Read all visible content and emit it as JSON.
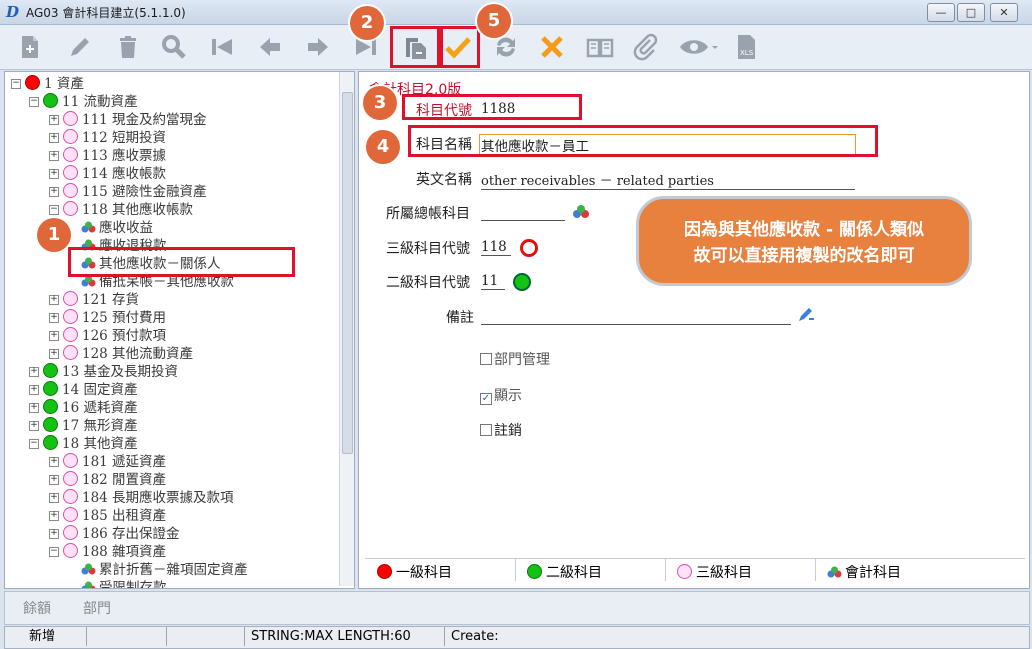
{
  "window": {
    "title": "AG03 會計科目建立(5.1.1.0)",
    "logo": "D",
    "minimize": "—",
    "restore": "□",
    "close": "✕"
  },
  "toolbar": {
    "icons": [
      "new-doc-icon",
      "edit-pencil-icon",
      "delete-trash-icon",
      "search-magnifier-icon",
      "first-record-icon",
      "previous-record-icon",
      "next-record-icon",
      "last-record-icon",
      "copy-icon",
      "confirm-check-icon",
      "refresh-icon",
      "cancel-x-icon",
      "book-icon",
      "attach-clip-icon",
      "view-eye-icon",
      "export-xls-icon"
    ],
    "xls_label": "XLS"
  },
  "tree": {
    "nodes": [
      {
        "label": "1 資產",
        "dot": "red",
        "level": 0,
        "exp": "−"
      },
      {
        "label": "11 流動資產",
        "dot": "green",
        "level": 1,
        "exp": "−"
      },
      {
        "label": "111 現金及約當現金",
        "dot": "pink",
        "level": 2,
        "exp": "+"
      },
      {
        "label": "112 短期投資",
        "dot": "pink",
        "level": 2,
        "exp": "+"
      },
      {
        "label": "113 應收票據",
        "dot": "pink",
        "level": 2,
        "exp": "+"
      },
      {
        "label": "114 應收帳款",
        "dot": "pink",
        "level": 2,
        "exp": "+"
      },
      {
        "label": "115 避險性金融資產",
        "dot": "pink",
        "level": 2,
        "exp": "+"
      },
      {
        "label": "118 其他應收帳款",
        "dot": "pink",
        "level": 2,
        "exp": "−"
      },
      {
        "label": "應收收益",
        "dot": "acct",
        "level": 3,
        "exp": ""
      },
      {
        "label": "應收退稅款",
        "dot": "acct",
        "level": 3,
        "exp": ""
      },
      {
        "label": "其他應收款－關係人",
        "dot": "acct",
        "level": 3,
        "exp": ""
      },
      {
        "label": "備抵呆帳－其他應收款",
        "dot": "acct",
        "level": 3,
        "exp": ""
      },
      {
        "label": "121 存貨",
        "dot": "pink",
        "level": 2,
        "exp": "+"
      },
      {
        "label": "125 預付費用",
        "dot": "pink",
        "level": 2,
        "exp": "+"
      },
      {
        "label": "126 預付款項",
        "dot": "pink",
        "level": 2,
        "exp": "+"
      },
      {
        "label": "128 其他流動資產",
        "dot": "pink",
        "level": 2,
        "exp": "+"
      },
      {
        "label": "13 基金及長期投資",
        "dot": "green",
        "level": 1,
        "exp": "+"
      },
      {
        "label": "14 固定資產",
        "dot": "green",
        "level": 1,
        "exp": "+"
      },
      {
        "label": "16 遞耗資產",
        "dot": "green",
        "level": 1,
        "exp": "+"
      },
      {
        "label": "17 無形資產",
        "dot": "green",
        "level": 1,
        "exp": "+"
      },
      {
        "label": "18 其他資產",
        "dot": "green",
        "level": 1,
        "exp": "−"
      },
      {
        "label": "181 遞延資產",
        "dot": "pink",
        "level": 2,
        "exp": "+"
      },
      {
        "label": "182 閒置資產",
        "dot": "pink",
        "level": 2,
        "exp": "+"
      },
      {
        "label": "184 長期應收票據及款項",
        "dot": "pink",
        "level": 2,
        "exp": "+"
      },
      {
        "label": "185 出租資產",
        "dot": "pink",
        "level": 2,
        "exp": "+"
      },
      {
        "label": "186 存出保證金",
        "dot": "pink",
        "level": 2,
        "exp": "+"
      },
      {
        "label": "188 雜項資產",
        "dot": "pink",
        "level": 2,
        "exp": "−"
      },
      {
        "label": "累計折舊－雜項固定資產",
        "dot": "acct",
        "level": 3,
        "exp": ""
      },
      {
        "label": "受限制存款",
        "dot": "acct",
        "level": 3,
        "exp": ""
      }
    ]
  },
  "detail": {
    "version_label": "會計科目2.0版",
    "code_label": "科目代號",
    "code_value": "1188",
    "name_label": "科目名稱",
    "name_value": "其他應收款－員工",
    "en_label": "英文名稱",
    "en_value": "other receivables － related parties",
    "parent_label": "所屬總帳科目",
    "parent_value": "",
    "lvl3_label": "三級科目代號",
    "lvl3_value": "118",
    "lvl2_label": "二級科目代號",
    "lvl2_value": "11",
    "note_label": "備註",
    "note_value": "",
    "dept_label": "部門管理",
    "show_label": "顯示",
    "void_label": "註銷",
    "check_mark": "✓"
  },
  "callout": {
    "line1": "因為與其他應收款 - 關係人類似",
    "line2": "故可以直接用複製的改名即可"
  },
  "badges": {
    "b1": "1",
    "b2": "2",
    "b3": "3",
    "b4": "4",
    "b5": "5"
  },
  "legend": {
    "l1": "一級科目",
    "l2": "二級科目",
    "l3": "三級科目",
    "l4": "會計科目"
  },
  "bottom_tabs": {
    "t1": "餘額",
    "t2": "部門"
  },
  "status": {
    "mode": "新增",
    "s2": "",
    "s3": "",
    "info": "STRING:MAX LENGTH:60",
    "create": "Create:"
  },
  "colors": {
    "accent_red": "#e0102d",
    "badge": "#e0673a",
    "callout": "#e8813e"
  }
}
